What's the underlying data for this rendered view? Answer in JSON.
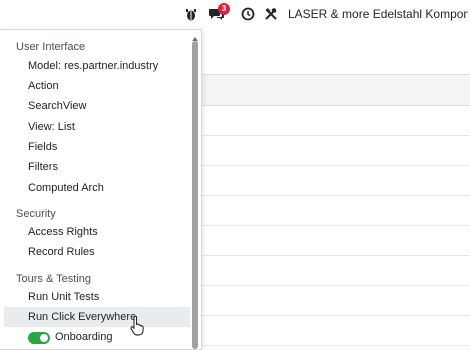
{
  "topbar": {
    "icons": [
      "bug-icon",
      "chat-icon",
      "clock-icon",
      "tools-icon"
    ],
    "message_count": "3",
    "badge_color": "#e01e3c",
    "company": "LASER & more Edelstahl Komponent..."
  },
  "menu": {
    "sections": [
      {
        "title": "User Interface",
        "items": [
          "Model: res.partner.industry",
          "Action",
          "SearchView",
          "View: List",
          "Fields",
          "Filters",
          "Computed Arch"
        ]
      },
      {
        "title": "Security",
        "items": [
          "Access Rights",
          "Record Rules"
        ]
      },
      {
        "title": "Tours & Testing",
        "items": [
          "Run Unit Tests",
          "Run Click Everywhere"
        ],
        "toggle": {
          "label": "Onboarding",
          "on": true,
          "color": "#28a745"
        }
      }
    ],
    "hovered_item": "Run Click Everywhere"
  }
}
